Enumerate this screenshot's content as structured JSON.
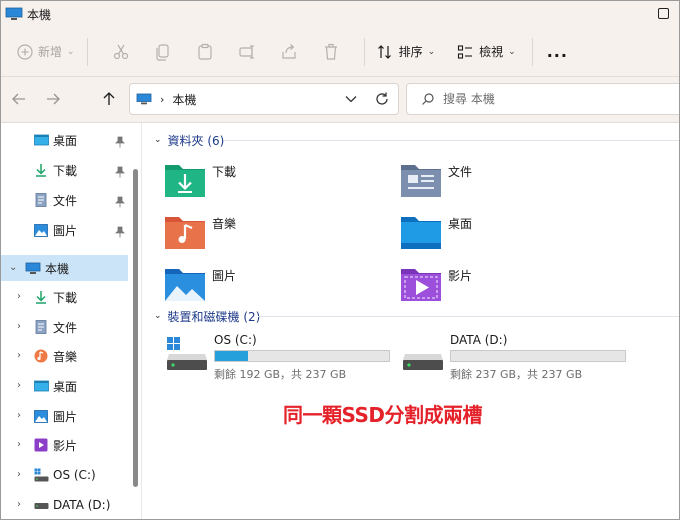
{
  "window": {
    "title": "本機"
  },
  "toolbar": {
    "new_label": "新增",
    "sort_label": "排序",
    "view_label": "檢視",
    "more_label": "..."
  },
  "address": {
    "crumb": "本機"
  },
  "search": {
    "placeholder": "搜尋 本機"
  },
  "sidebar": {
    "quick_access": [
      {
        "label": "桌面",
        "icon": "desktop-icon"
      },
      {
        "label": "下載",
        "icon": "download-icon"
      },
      {
        "label": "文件",
        "icon": "document-icon"
      },
      {
        "label": "圖片",
        "icon": "picture-icon"
      }
    ],
    "this_pc": {
      "label": "本機",
      "icon": "computer-icon"
    },
    "children": [
      {
        "label": "下載",
        "icon": "download-icon"
      },
      {
        "label": "文件",
        "icon": "document-icon"
      },
      {
        "label": "音樂",
        "icon": "music-icon"
      },
      {
        "label": "桌面",
        "icon": "desktop-icon"
      },
      {
        "label": "圖片",
        "icon": "picture-icon"
      },
      {
        "label": "影片",
        "icon": "video-icon"
      },
      {
        "label": "OS (C:)",
        "icon": "windows-drive-icon"
      },
      {
        "label": "DATA (D:)",
        "icon": "drive-icon"
      }
    ]
  },
  "content": {
    "folders_group": {
      "label": "資料夾 (6)"
    },
    "folders": [
      {
        "label": "下載",
        "icon": "download-folder-icon"
      },
      {
        "label": "文件",
        "icon": "documents-folder-icon"
      },
      {
        "label": "音樂",
        "icon": "music-folder-icon"
      },
      {
        "label": "桌面",
        "icon": "desktop-folder-icon"
      },
      {
        "label": "圖片",
        "icon": "pictures-folder-icon"
      },
      {
        "label": "影片",
        "icon": "videos-folder-icon"
      }
    ],
    "drives_group": {
      "label": "裝置和磁碟機 (2)"
    },
    "drives": [
      {
        "name": "OS (C:)",
        "info": "剩餘 192 GB，共 237 GB",
        "used_fraction": 0.19
      },
      {
        "name": "DATA (D:)",
        "info": "剩餘 237 GB，共 237 GB",
        "used_fraction": 0.0
      }
    ]
  },
  "annotation": {
    "text": "同一顆SSD分割成兩槽"
  },
  "colors": {
    "accent": "#26a0da",
    "selection": "#cce4f7",
    "annotation": "#e5222a",
    "group_header": "#1f3a8a"
  }
}
